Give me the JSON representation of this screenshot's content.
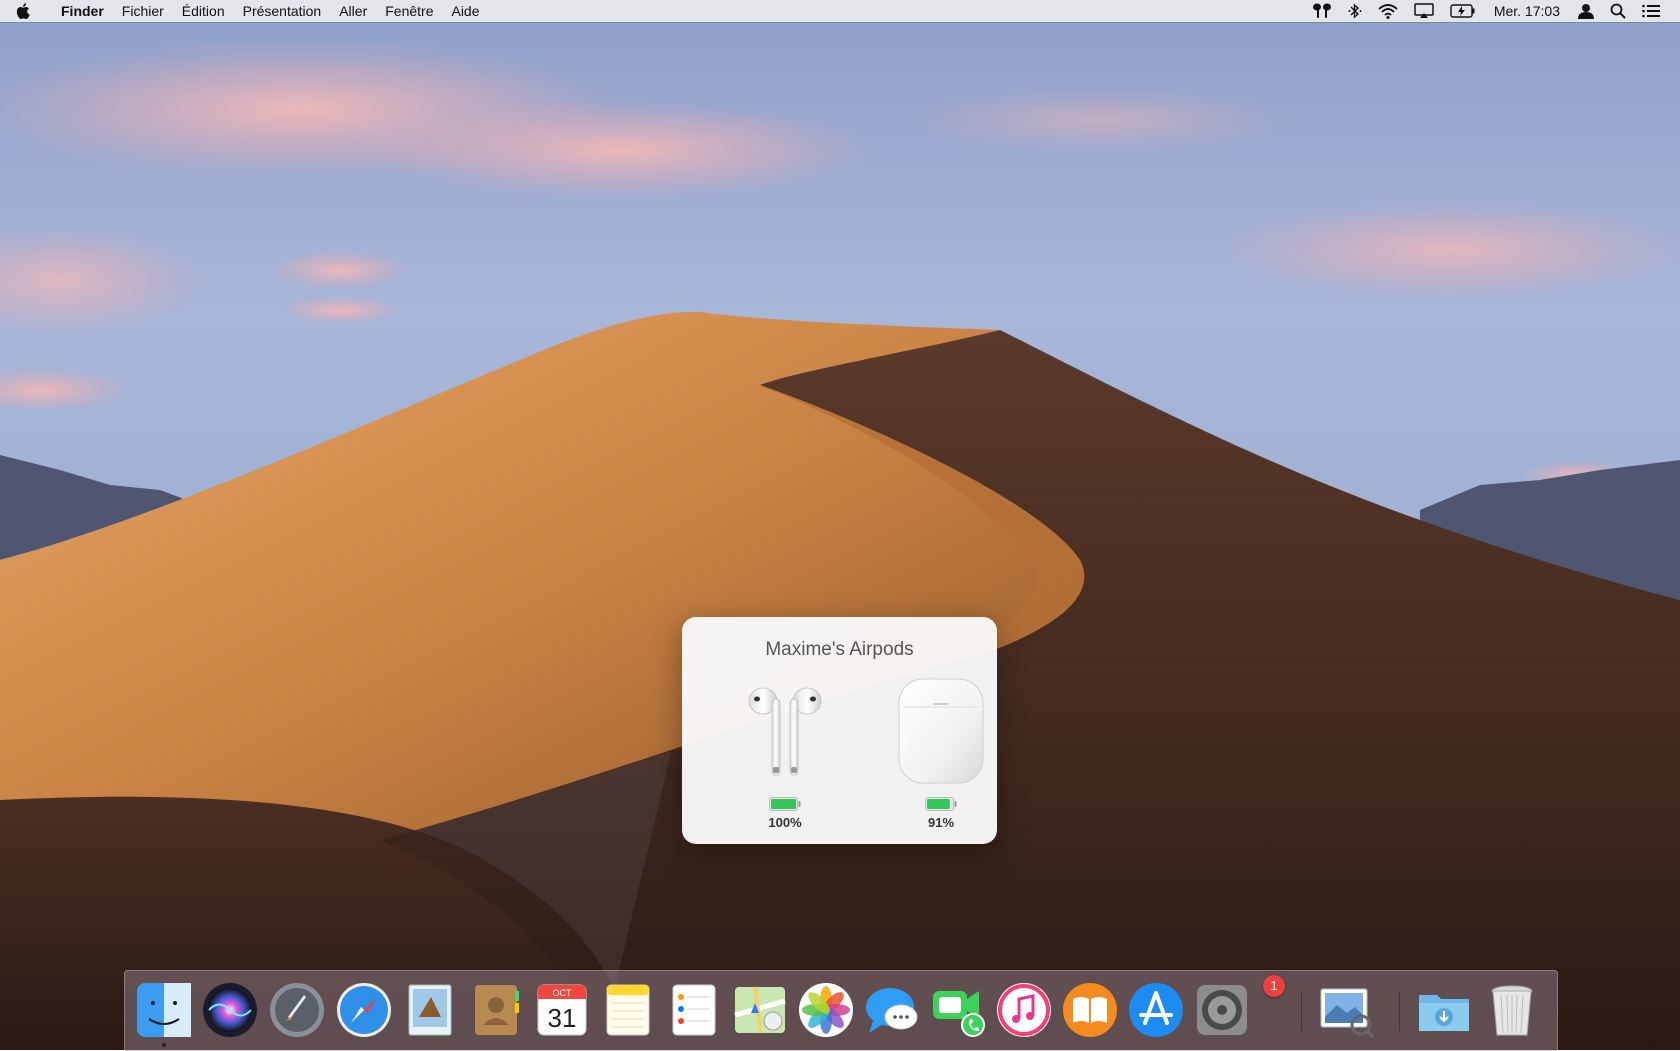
{
  "menubar": {
    "app_name": "Finder",
    "menus": [
      "Fichier",
      "Édition",
      "Présentation",
      "Aller",
      "Fenêtre",
      "Aide"
    ],
    "clock": "Mer. 17:03",
    "status_icons": [
      "airpods-icon",
      "bluetooth-icon",
      "wifi-icon",
      "airplay-icon",
      "battery-charging-icon",
      "user-icon",
      "spotlight-icon",
      "notification-center-icon"
    ]
  },
  "popup": {
    "title": "Maxime's Airpods",
    "devices": [
      {
        "name": "airpods-buds",
        "battery": "100%",
        "level": 1.0
      },
      {
        "name": "airpods-case",
        "battery": "91%",
        "level": 0.91
      }
    ],
    "battery_color": "#34c759"
  },
  "dock": {
    "apps": [
      "finder",
      "siri",
      "launchpad",
      "safari",
      "mail",
      "contacts",
      "calendar",
      "notes",
      "reminders",
      "maps",
      "photos",
      "messages",
      "facetime",
      "itunes",
      "books",
      "app-store",
      "system-preferences",
      "preview",
      "downloads",
      "trash"
    ],
    "calendar": {
      "month": "OCT",
      "day": "31"
    },
    "system_prefs_badge": "1"
  }
}
